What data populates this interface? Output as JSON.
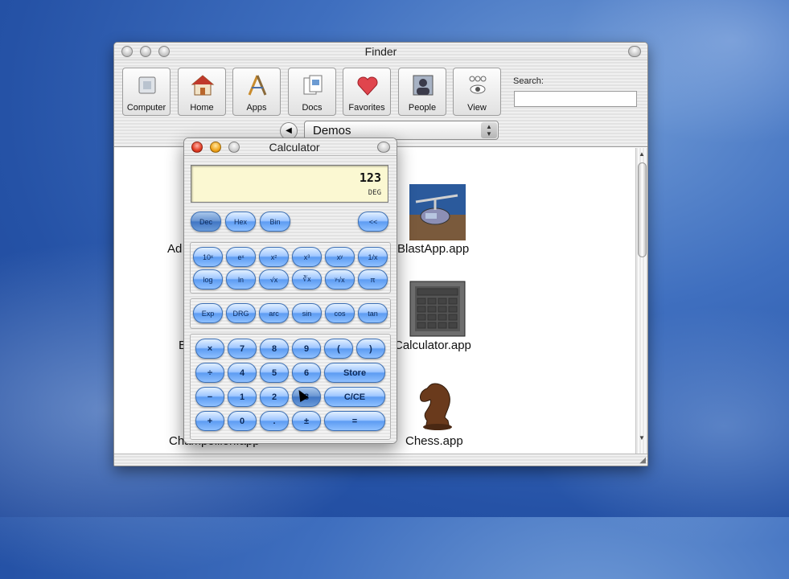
{
  "finder": {
    "title": "Finder",
    "toolbar": [
      {
        "label": "Computer",
        "icon": "computer-icon"
      },
      {
        "label": "Home",
        "icon": "home-icon"
      },
      {
        "label": "Apps",
        "icon": "apps-icon"
      },
      {
        "label": "Docs",
        "icon": "docs-icon"
      },
      {
        "label": "Favorites",
        "icon": "favorites-icon"
      },
      {
        "label": "People",
        "icon": "people-icon"
      },
      {
        "label": "View",
        "icon": "view-icon"
      }
    ],
    "search_label": "Search:",
    "search_value": "",
    "path": "Demos",
    "items": [
      {
        "label": "Ad",
        "icon": "",
        "partially_hidden": true
      },
      {
        "label": "BlastApp.app",
        "icon": "blastapp-icon"
      },
      {
        "label": "B",
        "icon": "",
        "partially_hidden": true
      },
      {
        "label": "Calculator.app",
        "icon": "calculator-app-icon"
      },
      {
        "label": "Champollion.app",
        "icon": "",
        "partially_hidden": true
      },
      {
        "label": "Chess.app",
        "icon": "chess-icon"
      }
    ]
  },
  "calculator": {
    "title": "Calculator",
    "display": {
      "value": "123",
      "mode": "DEG"
    },
    "base_keys": [
      "Dec",
      "Hex",
      "Bin"
    ],
    "back_key": "<<",
    "sci_row1": [
      "10ˣ",
      "eˣ",
      "x²",
      "x³",
      "xʸ",
      "1/x"
    ],
    "sci_row2": [
      "log",
      "ln",
      "√x",
      "∛x",
      "ʸ√x",
      "π"
    ],
    "trig_row": [
      "Exp",
      "DRG",
      "arc",
      "sin",
      "cos",
      "tan"
    ],
    "num_rows": [
      [
        "×",
        "7",
        "8",
        "9",
        "(",
        ")"
      ],
      [
        "÷",
        "4",
        "5",
        "6",
        "Store"
      ],
      [
        "−",
        "1",
        "2",
        "3",
        "C/CE"
      ],
      [
        "+",
        "0",
        ".",
        "±",
        "="
      ]
    ]
  }
}
